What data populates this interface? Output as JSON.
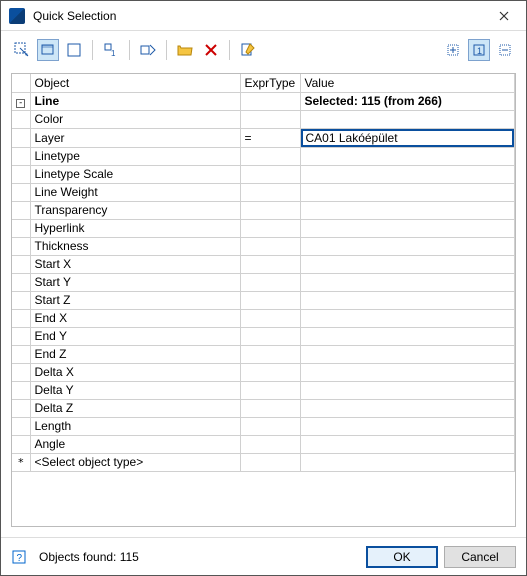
{
  "window": {
    "title": "Quick Selection"
  },
  "columns": {
    "object": "Object",
    "expr": "ExprType",
    "value": "Value"
  },
  "header_row": {
    "object": "Line",
    "value": "Selected: 115 (from 266)"
  },
  "layer_row": {
    "label": "Layer",
    "expr": "=",
    "value": "CA01 Lakóépület"
  },
  "rows": [
    "Color",
    "Linetype",
    "Linetype Scale",
    "Line Weight",
    "Transparency",
    "Hyperlink",
    "Thickness",
    "Start X",
    "Start Y",
    "Start Z",
    "End X",
    "End Y",
    "End Z",
    "Delta X",
    "Delta Y",
    "Delta Z",
    "Length",
    "Angle"
  ],
  "placeholder_row": {
    "marker": "*",
    "label": "<Select object type>"
  },
  "status": {
    "text": "Objects found: 115"
  },
  "buttons": {
    "ok": "OK",
    "cancel": "Cancel"
  }
}
